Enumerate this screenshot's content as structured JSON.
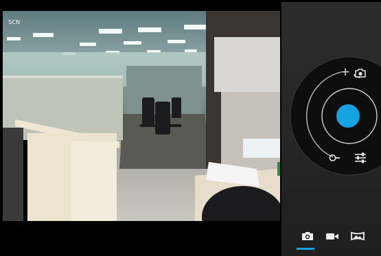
{
  "viewfinder": {
    "scene_mode_label": "SCN"
  },
  "controls": {
    "plus_symbol": "+",
    "shutter_color": "#14a3e0",
    "icons": {
      "switch_camera": "switch-camera-icon",
      "exposure_knob": "exposure-knob-icon",
      "settings": "settings-sliders-icon"
    }
  },
  "mode_bar": {
    "modes": [
      {
        "name": "camera",
        "icon": "camera-icon",
        "selected": true
      },
      {
        "name": "video",
        "icon": "video-icon",
        "selected": false
      },
      {
        "name": "panorama",
        "icon": "panorama-icon",
        "selected": false
      }
    ],
    "accent": "#14a3e0"
  }
}
